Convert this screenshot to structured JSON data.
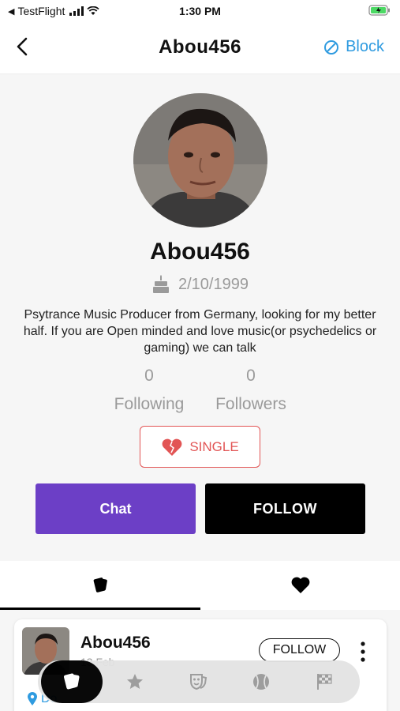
{
  "status_bar": {
    "carrier": "TestFlight",
    "time": "1:30 PM"
  },
  "nav": {
    "title": "Abou456",
    "block_label": "Block"
  },
  "profile": {
    "username": "Abou456",
    "birthdate": "2/10/1999",
    "bio": "Psytrance Music Producer from Germany, looking for my better half. If you are Open minded and love music(or psychedelics or gaming) we can talk",
    "following_count": "0",
    "following_label": "Following",
    "followers_count": "0",
    "followers_label": "Followers",
    "relationship_status": "SINGLE",
    "chat_label": "Chat",
    "follow_label": "FOLLOW"
  },
  "tabs": [
    {
      "icon": "cards-icon",
      "active": true
    },
    {
      "icon": "heart-icon",
      "active": false
    }
  ],
  "post": {
    "author": "Abou456",
    "date": "13 Feb",
    "follow_label": "FOLLOW",
    "location": "Do"
  },
  "bottom_nav": {
    "items": [
      "cards-icon",
      "star-icon",
      "masks-icon",
      "baseball-icon",
      "checkered-flag-icon"
    ],
    "active_index": 0
  },
  "colors": {
    "accent_blue": "#2f9be0",
    "chat_purple": "#6c3fc6",
    "single_red": "#e25555",
    "background_gray": "#f6f6f6"
  }
}
